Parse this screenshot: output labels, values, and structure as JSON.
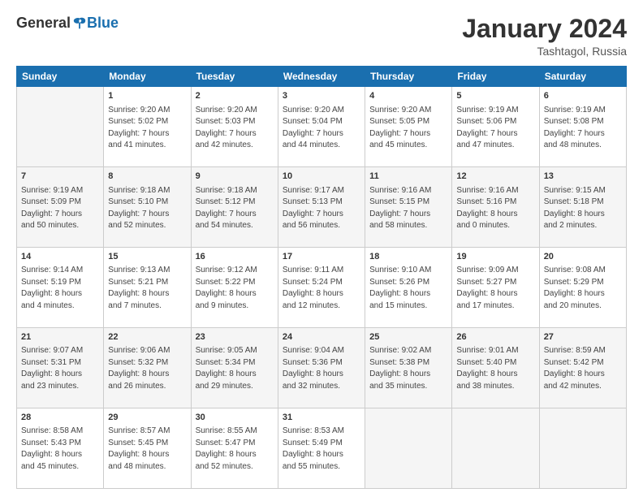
{
  "logo": {
    "general": "General",
    "blue": "Blue"
  },
  "title": "January 2024",
  "subtitle": "Tashtagol, Russia",
  "days_of_week": [
    "Sunday",
    "Monday",
    "Tuesday",
    "Wednesday",
    "Thursday",
    "Friday",
    "Saturday"
  ],
  "weeks": [
    [
      {
        "day": "",
        "info": ""
      },
      {
        "day": "1",
        "info": "Sunrise: 9:20 AM\nSunset: 5:02 PM\nDaylight: 7 hours\nand 41 minutes."
      },
      {
        "day": "2",
        "info": "Sunrise: 9:20 AM\nSunset: 5:03 PM\nDaylight: 7 hours\nand 42 minutes."
      },
      {
        "day": "3",
        "info": "Sunrise: 9:20 AM\nSunset: 5:04 PM\nDaylight: 7 hours\nand 44 minutes."
      },
      {
        "day": "4",
        "info": "Sunrise: 9:20 AM\nSunset: 5:05 PM\nDaylight: 7 hours\nand 45 minutes."
      },
      {
        "day": "5",
        "info": "Sunrise: 9:19 AM\nSunset: 5:06 PM\nDaylight: 7 hours\nand 47 minutes."
      },
      {
        "day": "6",
        "info": "Sunrise: 9:19 AM\nSunset: 5:08 PM\nDaylight: 7 hours\nand 48 minutes."
      }
    ],
    [
      {
        "day": "7",
        "info": "Sunrise: 9:19 AM\nSunset: 5:09 PM\nDaylight: 7 hours\nand 50 minutes."
      },
      {
        "day": "8",
        "info": "Sunrise: 9:18 AM\nSunset: 5:10 PM\nDaylight: 7 hours\nand 52 minutes."
      },
      {
        "day": "9",
        "info": "Sunrise: 9:18 AM\nSunset: 5:12 PM\nDaylight: 7 hours\nand 54 minutes."
      },
      {
        "day": "10",
        "info": "Sunrise: 9:17 AM\nSunset: 5:13 PM\nDaylight: 7 hours\nand 56 minutes."
      },
      {
        "day": "11",
        "info": "Sunrise: 9:16 AM\nSunset: 5:15 PM\nDaylight: 7 hours\nand 58 minutes."
      },
      {
        "day": "12",
        "info": "Sunrise: 9:16 AM\nSunset: 5:16 PM\nDaylight: 8 hours\nand 0 minutes."
      },
      {
        "day": "13",
        "info": "Sunrise: 9:15 AM\nSunset: 5:18 PM\nDaylight: 8 hours\nand 2 minutes."
      }
    ],
    [
      {
        "day": "14",
        "info": "Sunrise: 9:14 AM\nSunset: 5:19 PM\nDaylight: 8 hours\nand 4 minutes."
      },
      {
        "day": "15",
        "info": "Sunrise: 9:13 AM\nSunset: 5:21 PM\nDaylight: 8 hours\nand 7 minutes."
      },
      {
        "day": "16",
        "info": "Sunrise: 9:12 AM\nSunset: 5:22 PM\nDaylight: 8 hours\nand 9 minutes."
      },
      {
        "day": "17",
        "info": "Sunrise: 9:11 AM\nSunset: 5:24 PM\nDaylight: 8 hours\nand 12 minutes."
      },
      {
        "day": "18",
        "info": "Sunrise: 9:10 AM\nSunset: 5:26 PM\nDaylight: 8 hours\nand 15 minutes."
      },
      {
        "day": "19",
        "info": "Sunrise: 9:09 AM\nSunset: 5:27 PM\nDaylight: 8 hours\nand 17 minutes."
      },
      {
        "day": "20",
        "info": "Sunrise: 9:08 AM\nSunset: 5:29 PM\nDaylight: 8 hours\nand 20 minutes."
      }
    ],
    [
      {
        "day": "21",
        "info": "Sunrise: 9:07 AM\nSunset: 5:31 PM\nDaylight: 8 hours\nand 23 minutes."
      },
      {
        "day": "22",
        "info": "Sunrise: 9:06 AM\nSunset: 5:32 PM\nDaylight: 8 hours\nand 26 minutes."
      },
      {
        "day": "23",
        "info": "Sunrise: 9:05 AM\nSunset: 5:34 PM\nDaylight: 8 hours\nand 29 minutes."
      },
      {
        "day": "24",
        "info": "Sunrise: 9:04 AM\nSunset: 5:36 PM\nDaylight: 8 hours\nand 32 minutes."
      },
      {
        "day": "25",
        "info": "Sunrise: 9:02 AM\nSunset: 5:38 PM\nDaylight: 8 hours\nand 35 minutes."
      },
      {
        "day": "26",
        "info": "Sunrise: 9:01 AM\nSunset: 5:40 PM\nDaylight: 8 hours\nand 38 minutes."
      },
      {
        "day": "27",
        "info": "Sunrise: 8:59 AM\nSunset: 5:42 PM\nDaylight: 8 hours\nand 42 minutes."
      }
    ],
    [
      {
        "day": "28",
        "info": "Sunrise: 8:58 AM\nSunset: 5:43 PM\nDaylight: 8 hours\nand 45 minutes."
      },
      {
        "day": "29",
        "info": "Sunrise: 8:57 AM\nSunset: 5:45 PM\nDaylight: 8 hours\nand 48 minutes."
      },
      {
        "day": "30",
        "info": "Sunrise: 8:55 AM\nSunset: 5:47 PM\nDaylight: 8 hours\nand 52 minutes."
      },
      {
        "day": "31",
        "info": "Sunrise: 8:53 AM\nSunset: 5:49 PM\nDaylight: 8 hours\nand 55 minutes."
      },
      {
        "day": "",
        "info": ""
      },
      {
        "day": "",
        "info": ""
      },
      {
        "day": "",
        "info": ""
      }
    ]
  ]
}
